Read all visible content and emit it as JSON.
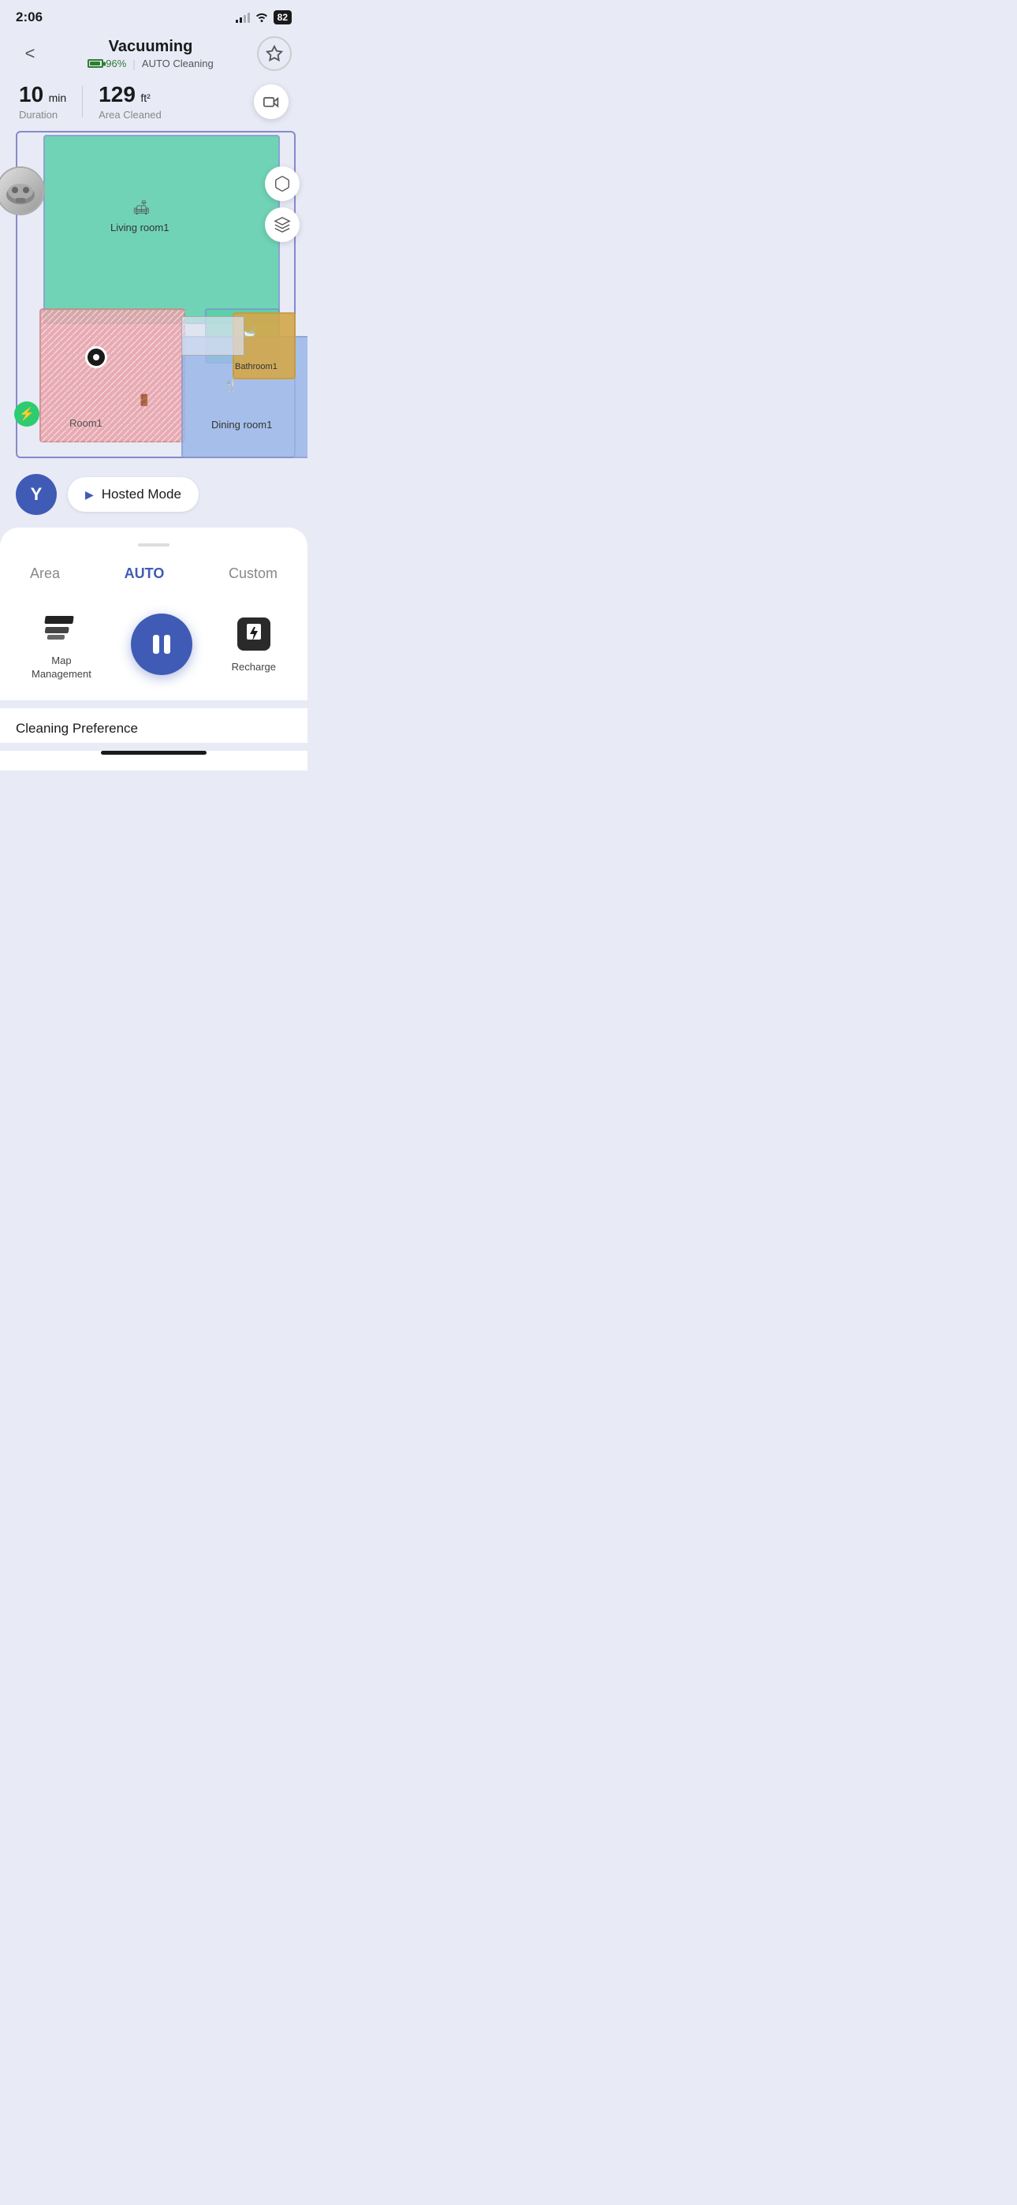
{
  "statusBar": {
    "time": "2:06",
    "battery": "82"
  },
  "header": {
    "title": "Vacuuming",
    "batteryPercent": "96%",
    "mode": "AUTO Cleaning",
    "backLabel": "<",
    "settingsLabel": "⚙"
  },
  "stats": {
    "duration": "10",
    "durationUnit": "min",
    "durationLabel": "Duration",
    "area": "129",
    "areaUnit": "ft²",
    "areaLabel": "Area Cleaned"
  },
  "map": {
    "rooms": [
      {
        "name": "Living room1",
        "color": "#5ccfaa"
      },
      {
        "name": "Room1",
        "color": "#e8a0a8"
      },
      {
        "name": "Dining room1",
        "color": "#9bb8e8"
      },
      {
        "name": "Bathroom1",
        "color": "#d4a84b"
      }
    ]
  },
  "hostedMode": {
    "buttonLabel": "Hosted Mode",
    "avatarLetter": "Y"
  },
  "bottomCard": {
    "dragHandle": "",
    "tabs": [
      {
        "label": "Area",
        "active": false
      },
      {
        "label": "AUTO",
        "active": true
      },
      {
        "label": "Custom",
        "active": false
      }
    ],
    "controls": [
      {
        "label": "Map\nManagement",
        "icon": "map-management"
      },
      {
        "label": "pause",
        "icon": "pause"
      },
      {
        "label": "Recharge",
        "icon": "recharge"
      }
    ]
  },
  "cleaningPreference": {
    "label": "Cleaning Preference"
  }
}
